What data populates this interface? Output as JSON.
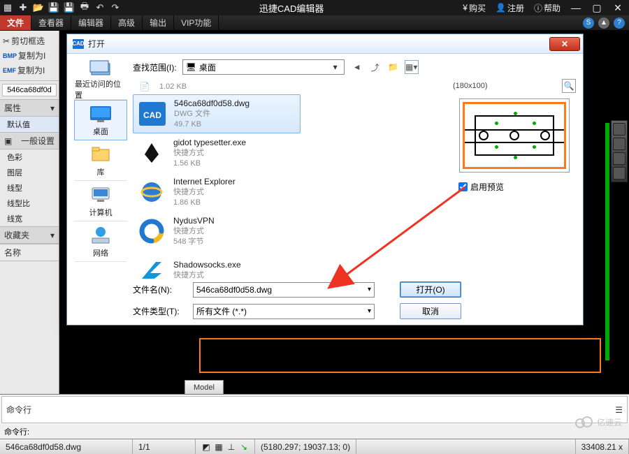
{
  "titlebar": {
    "app_title": "迅捷CAD编辑器"
  },
  "tb_right": {
    "buy": "购买",
    "register": "注册",
    "help": "帮助"
  },
  "ribbon": {
    "file": "文件",
    "viewer": "查看器",
    "editor": "编辑器",
    "advanced": "高级",
    "output": "输出",
    "vip": "VIP功能"
  },
  "left_panel": {
    "copy_rows": [
      "剪切框选",
      "复制为I",
      "复制为I"
    ],
    "doc_tab": "546ca68df0d",
    "props_hdr": "属性",
    "defaults": "默认值",
    "general_hdr": "一般设置",
    "general_items": [
      "色彩",
      "图层",
      "线型",
      "线型比",
      "线宽"
    ],
    "fav_hdr": "收藏夹",
    "name_hdr": "名称"
  },
  "dialog": {
    "title": "打开",
    "closeX": "✕",
    "lookin_label": "查找范围(I):",
    "lookin_value": "桌面",
    "places": [
      {
        "l": "最近访问的位置"
      },
      {
        "l": "桌面",
        "sel": true
      },
      {
        "l": "库"
      },
      {
        "l": "计算机"
      },
      {
        "l": "网络"
      }
    ],
    "files": [
      {
        "micro": true,
        "name": "",
        "type": "",
        "size": "1.02 KB"
      },
      {
        "sel": true,
        "name": "546ca68df0d58.dwg",
        "type": "DWG 文件",
        "size": "49.7 KB",
        "icon": "cad"
      },
      {
        "name": "gidot typesetter.exe",
        "type": "快捷方式",
        "size": "1.56 KB",
        "icon": "pen"
      },
      {
        "name": "Internet Explorer",
        "type": "快捷方式",
        "size": "1.86 KB",
        "icon": "ie"
      },
      {
        "name": "NydusVPN",
        "type": "快捷方式",
        "size": "548 字节",
        "icon": "nydus"
      },
      {
        "name": "Shadowsocks.exe",
        "type": "快捷方式",
        "size": "",
        "icon": "ss"
      }
    ],
    "preview_dim": "(180x100)",
    "enable_preview": "启用预览",
    "filename_label": "文件名(N):",
    "filename_value": "546ca68df0d58.dwg",
    "filetype_label": "文件类型(T):",
    "filetype_value": "所有文件 (*.*)",
    "open_btn": "打开(O)",
    "cancel_btn": "取消"
  },
  "model_tab": "Model",
  "cmd": {
    "line": "命令行",
    "prompt": "命令行:",
    "chev": "☰"
  },
  "status": {
    "file": "546ca68df0d58.dwg",
    "pages": "1/1",
    "coords": "(5180.297; 19037.13; 0)",
    "num": "33408.21 x"
  },
  "watermark": "亿速云"
}
